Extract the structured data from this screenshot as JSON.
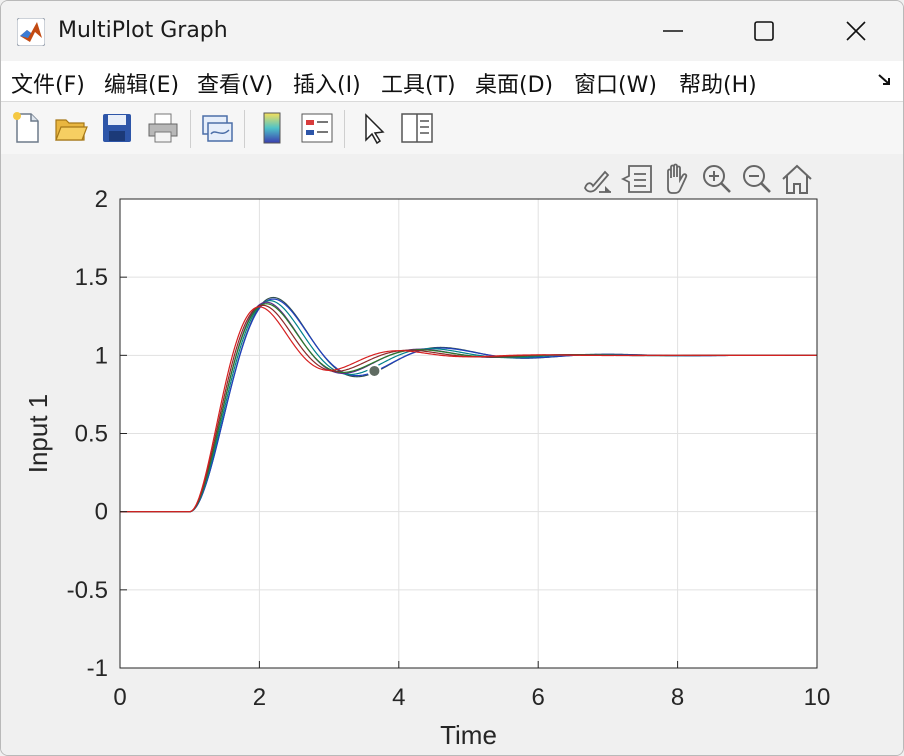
{
  "window": {
    "title": "MultiPlot Graph"
  },
  "menu": {
    "items": [
      "文件(F)",
      "编辑(E)",
      "查看(V)",
      "插入(I)",
      "工具(T)",
      "桌面(D)",
      "窗口(W)",
      "帮助(H)"
    ],
    "overflow_icon": "overflow-arrow-icon"
  },
  "toolbar": {
    "icons": [
      "new-figure-icon",
      "open-file-icon",
      "save-icon",
      "print-icon",
      "link-plot-icon",
      "insert-colorbar-icon",
      "insert-legend-icon",
      "edit-plot-arrow-icon",
      "property-inspector-icon"
    ]
  },
  "axes_toolbar": {
    "icons": [
      "brush-data-icon",
      "data-tips-icon",
      "pan-hand-icon",
      "zoom-in-icon",
      "zoom-out-icon",
      "restore-view-home-icon"
    ]
  },
  "chart_data": {
    "type": "line",
    "title": "",
    "xlabel": "Time",
    "ylabel": "Input 1",
    "xlim": [
      0,
      10
    ],
    "ylim": [
      -1,
      2
    ],
    "xticks": [
      0,
      2,
      4,
      6,
      8,
      10
    ],
    "xtick_labels": [
      "0",
      "2",
      "4",
      "6",
      "8",
      "10"
    ],
    "yticks": [
      -1,
      -0.5,
      0,
      0.5,
      1,
      1.5,
      2
    ],
    "ytick_labels": [
      "-1",
      "-0.5",
      "0",
      "0.5",
      "1",
      "1.5",
      "2"
    ],
    "grid": true,
    "step_time": 1.0,
    "final_value": 1.0,
    "series": [
      {
        "color": "#2f4f4f",
        "overshoot_peak": 1.37,
        "peak_time": 2.2
      },
      {
        "color": "#1f3fbf",
        "overshoot_peak": 1.36,
        "peak_time": 2.2
      },
      {
        "color": "#00808a",
        "overshoot_peak": 1.35,
        "peak_time": 2.15
      },
      {
        "color": "#5a2a8a",
        "overshoot_peak": 1.34,
        "peak_time": 2.1
      },
      {
        "color": "#2a7a2a",
        "overshoot_peak": 1.33,
        "peak_time": 2.1
      },
      {
        "color": "#8b2a2a",
        "overshoot_peak": 1.32,
        "peak_time": 2.05
      },
      {
        "color": "#d62020",
        "overshoot_peak": 1.31,
        "peak_time": 2.0
      }
    ],
    "marker": {
      "x": 3.65,
      "y": 0.9,
      "color": "#5f6b62"
    }
  }
}
